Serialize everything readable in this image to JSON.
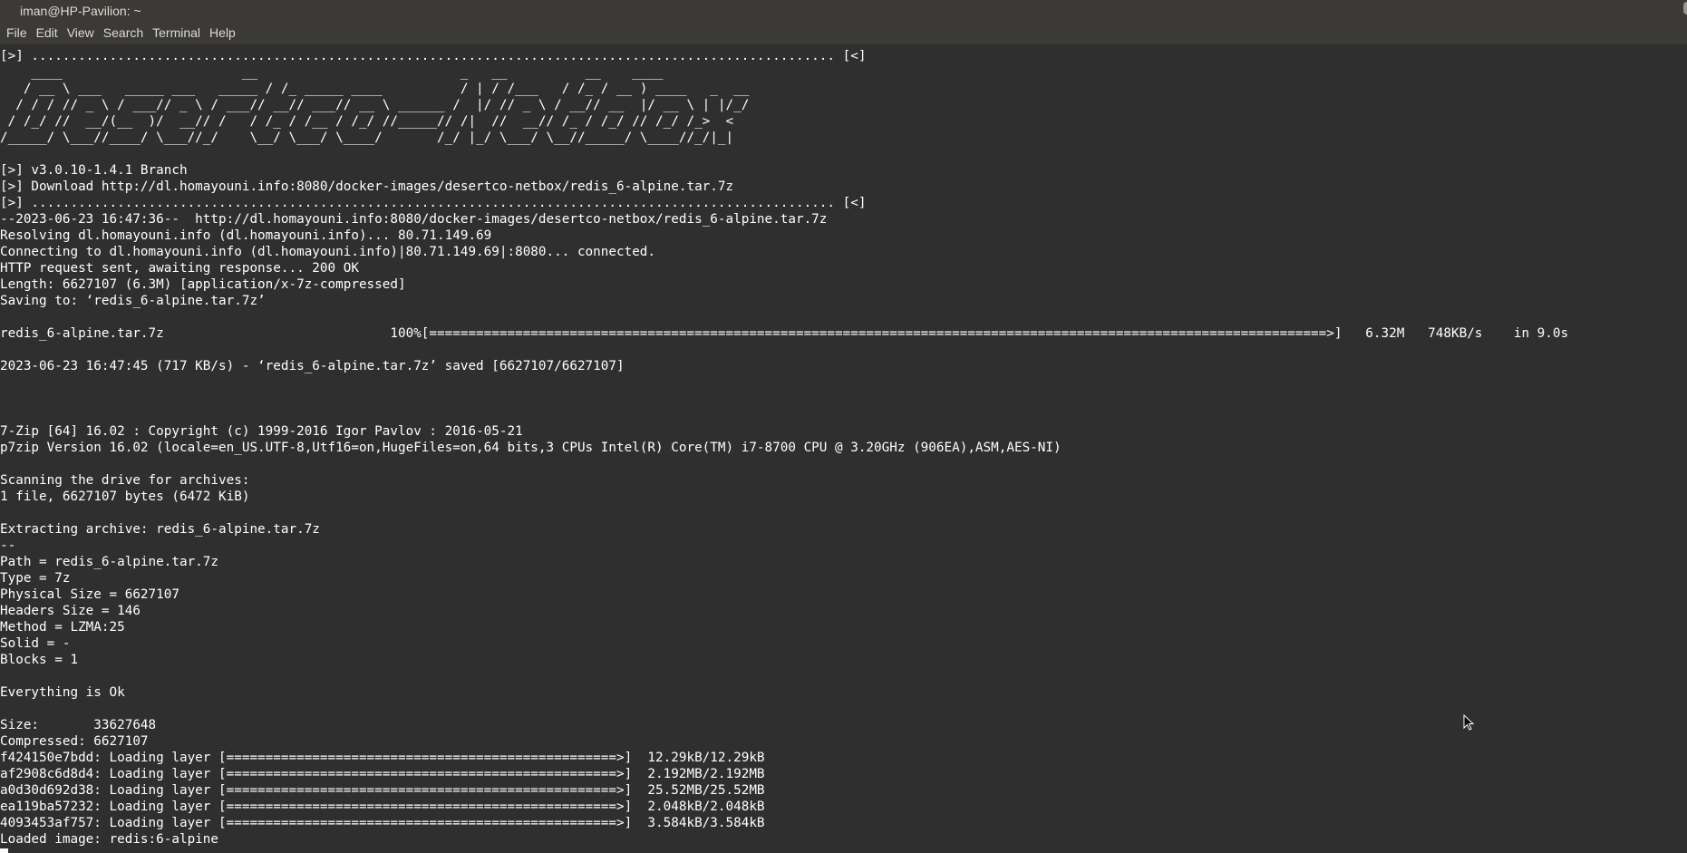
{
  "window": {
    "title": "iman@HP-Pavilion: ~"
  },
  "menu": {
    "items": [
      "File",
      "Edit",
      "View",
      "Search",
      "Terminal",
      "Help"
    ]
  },
  "terminal": {
    "lines": [
      "[>] ....................................................................................................... [<]",
      "    ____                       __                          _   __          __    ____",
      "   / __ \\ ___   _____ ___   _____ / /_ _____ ____          / | / /___   / /_ / __ ) ____   _  __",
      "  / / / // _ \\ / ___// _ \\ / ___// __// ___// __ \\ ______ /  |/ // _ \\ / __// __  |/ __ \\ | |/_/",
      " / /_/ //  __/(__  )/  __// /   / /_ / /__ / /_/ //_____// /|  //  __// /_ / /_/ // /_/ /_>  <",
      "/_____/ \\___//____/ \\___//_/    \\__/ \\___/ \\____/       /_/ |_/ \\___/ \\__//_____/ \\____//_/|_|",
      "",
      "[>] v3.0.10-1.4.1 Branch",
      "[>] Download http://dl.homayouni.info:8080/docker-images/desertco-netbox/redis_6-alpine.tar.7z",
      "[>] ....................................................................................................... [<]",
      "--2023-06-23 16:47:36--  http://dl.homayouni.info:8080/docker-images/desertco-netbox/redis_6-alpine.tar.7z",
      "Resolving dl.homayouni.info (dl.homayouni.info)... 80.71.149.69",
      "Connecting to dl.homayouni.info (dl.homayouni.info)|80.71.149.69|:8080... connected.",
      "HTTP request sent, awaiting response... 200 OK",
      "Length: 6627107 (6.3M) [application/x-7z-compressed]",
      "Saving to: ‘redis_6-alpine.tar.7z’",
      "",
      "redis_6-alpine.tar.7z                             100%[===================================================================================================================>]   6.32M   748KB/s    in 9.0s",
      "",
      "2023-06-23 16:47:45 (717 KB/s) - ‘redis_6-alpine.tar.7z’ saved [6627107/6627107]",
      "",
      "",
      "",
      "7-Zip [64] 16.02 : Copyright (c) 1999-2016 Igor Pavlov : 2016-05-21",
      "p7zip Version 16.02 (locale=en_US.UTF-8,Utf16=on,HugeFiles=on,64 bits,3 CPUs Intel(R) Core(TM) i7-8700 CPU @ 3.20GHz (906EA),ASM,AES-NI)",
      "",
      "Scanning the drive for archives:",
      "1 file, 6627107 bytes (6472 KiB)",
      "",
      "Extracting archive: redis_6-alpine.tar.7z",
      "--",
      "Path = redis_6-alpine.tar.7z",
      "Type = 7z",
      "Physical Size = 6627107",
      "Headers Size = 146",
      "Method = LZMA:25",
      "Solid = -",
      "Blocks = 1",
      "",
      "Everything is Ok",
      "",
      "Size:       33627648",
      "Compressed: 6627107",
      "f424150e7bdd: Loading layer [==================================================>]  12.29kB/12.29kB",
      "af2908c6d8d4: Loading layer [==================================================>]  2.192MB/2.192MB",
      "a0d30d692d38: Loading layer [==================================================>]  25.52MB/25.52MB",
      "ea119ba57232: Loading layer [==================================================>]  2.048kB/2.048kB",
      "4093453af757: Loading layer [==================================================>]  3.584kB/3.584kB",
      "Loaded image: redis:6-alpine"
    ]
  }
}
